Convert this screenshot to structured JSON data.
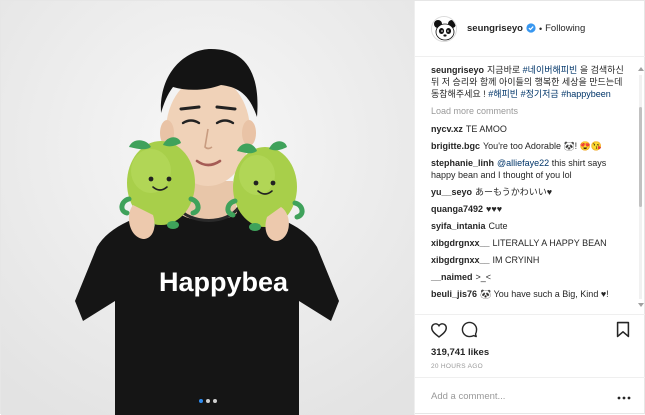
{
  "post": {
    "photo": {
      "shirt_text": "Happybea",
      "carousel": {
        "count": 3,
        "active": 0
      }
    },
    "header": {
      "username": "seungriseyo",
      "separator": "•",
      "follow_label": "Following"
    },
    "caption": {
      "username": "seungriseyo",
      "text_before": "지금바로 ",
      "tag1": "#네이버해피빈",
      "text_middle": " 을 검색하신뒤 저 승리와 함께 아이들의 행복한 세상을 만드는데 동참해주세요 ! ",
      "tag2": "#해피빈",
      "space1": " ",
      "tag3": "#정기저금",
      "space2": " ",
      "tag4": "#happybeen"
    },
    "load_more_label": "Load more comments",
    "comments": [
      {
        "user": "nycv.xz",
        "text": "TE AMOO"
      },
      {
        "user": "brigitte.bgc",
        "text": "You're too Adorable 🐼! 😍😘"
      },
      {
        "user": "stephanie_linh",
        "mention": "@alliefaye22",
        "text": " this shirt says happy bean and I thought of you lol"
      },
      {
        "user": "yu__seyo",
        "text": "あーもうかわいい♥"
      },
      {
        "user": "quanga7492",
        "text": "♥♥♥"
      },
      {
        "user": "syifa_intania",
        "text": "Cute"
      },
      {
        "user": "xibgdrgnxx__",
        "text": "LITERALLY A HAPPY BEAN"
      },
      {
        "user": "xibgdrgnxx__",
        "text": "IM CRYINH"
      },
      {
        "user": "__naimed",
        "text": ">_<"
      },
      {
        "user": "beuli_jis76",
        "text": "🐼 You have such a Big, Kind ♥!"
      }
    ],
    "likes": "319,741 likes",
    "timestamp": "20 HOURS AGO",
    "add_comment_placeholder": "Add a comment...",
    "icons": {
      "like": "heart-icon",
      "comment": "comment-bubble-icon",
      "save": "bookmark-icon",
      "options": "more-options-icon",
      "verified": "verified-badge-icon"
    },
    "colors": {
      "accent": "#3897f0",
      "hashtag": "#003569",
      "muted": "#999999",
      "plush": "#a8cf4a",
      "leaf": "#3fa25b"
    }
  }
}
